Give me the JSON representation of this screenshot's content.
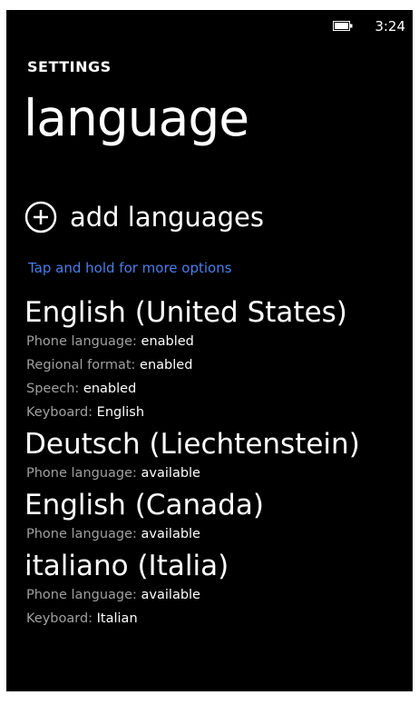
{
  "status_bar": {
    "time": "3:24",
    "battery_icon": "battery-icon"
  },
  "header": {
    "section": "SETTINGS",
    "title": "language"
  },
  "add_languages": {
    "icon": "plus-circle-icon",
    "label": "add languages"
  },
  "hint": "Tap and hold for more options",
  "colors": {
    "background": "#000000",
    "text": "#ffffff",
    "secondary_text": "#a0a0a0",
    "accent": "#4a7ee8"
  },
  "languages": [
    {
      "name": "English (United States)",
      "details": [
        {
          "key": "Phone language:",
          "value": "enabled"
        },
        {
          "key": "Regional format:",
          "value": "enabled"
        },
        {
          "key": "Speech:",
          "value": "enabled"
        },
        {
          "key": "Keyboard:",
          "value": "English"
        }
      ]
    },
    {
      "name": "Deutsch (Liechtenstein)",
      "details": [
        {
          "key": "Phone language:",
          "value": "available"
        }
      ]
    },
    {
      "name": "English (Canada)",
      "details": [
        {
          "key": "Phone language:",
          "value": "available"
        }
      ]
    },
    {
      "name": "italiano (Italia)",
      "details": [
        {
          "key": "Phone language:",
          "value": "available"
        },
        {
          "key": "Keyboard:",
          "value": "Italian"
        }
      ]
    }
  ]
}
